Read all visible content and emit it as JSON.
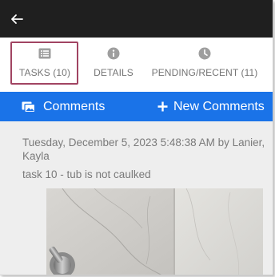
{
  "header": {
    "back_icon": "arrow-left-icon"
  },
  "tabs": [
    {
      "label": "TASKS (10)",
      "icon": "list-icon",
      "active": true
    },
    {
      "label": "DETAILS",
      "icon": "info-icon",
      "active": false
    },
    {
      "label": "PENDING/RECENT (11)",
      "icon": "clock-icon",
      "active": false
    }
  ],
  "toolbar": {
    "comments_label": "Comments",
    "comments_icon": "images-icon",
    "new_comments_label": "New Comments",
    "new_comments_icon": "plus-icon"
  },
  "comment": {
    "meta": "Tuesday, December 5, 2023 5:48:38 AM by Lanier, Kayla",
    "text": "task 10 - tub is not caulked",
    "photo_alt": "photo"
  },
  "colors": {
    "topbar": "#1f1f1f",
    "accent_blue": "#1a73e8",
    "highlight": "#a14462",
    "tab_text": "#757575",
    "content_bg": "#eeeeee"
  }
}
